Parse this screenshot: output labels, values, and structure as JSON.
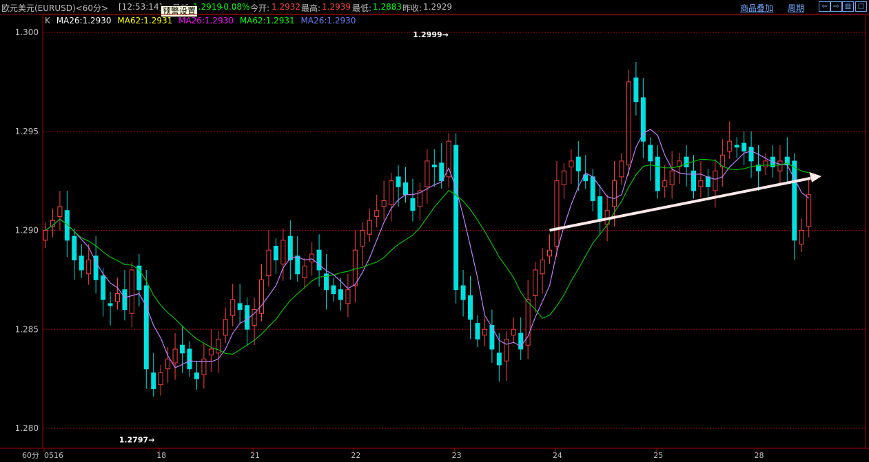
{
  "header": {
    "title": "欧元美元(EURUSD)<60分>",
    "time": "[12:53:14]",
    "latest_label": "最新:",
    "latest": "1.2919",
    "change": "-0.08%",
    "open_label": "今开:",
    "open": "1.2932",
    "high_label": "最高:",
    "high": "1.2939",
    "low_label": "最低:",
    "low": "1.2883",
    "prev_label": "昨收:",
    "prev": "1.2929",
    "overlay_link": "商品叠加",
    "period_link": "周期",
    "tooltip": "预警设置"
  },
  "legend": {
    "k": "K",
    "items": [
      {
        "text": "MA26:1.2930",
        "color": "#ffffff"
      },
      {
        "text": "MA62:1.2931",
        "color": "#ffff00"
      },
      {
        "text": "MA26:1.2930",
        "color": "#ff00ff"
      },
      {
        "text": "MA62:1.2931",
        "color": "#00ff00"
      },
      {
        "text": "MA26:1.2930",
        "color": "#6f7fff"
      }
    ]
  },
  "colors": {
    "up": "#ff4040",
    "down": "#00e0e0",
    "grid": "#a00000",
    "ma_short": "#c080ff",
    "ma_long": "#00c000"
  },
  "chart_data": {
    "type": "candlestick",
    "ylim": [
      1.2785,
      1.3015
    ],
    "yticks": [
      "1.300",
      "1.295",
      "1.290",
      "1.285",
      "1.280"
    ],
    "ytick_values": [
      1.3,
      1.295,
      1.29,
      1.285,
      1.28
    ],
    "period_label": "60分",
    "xticks": [
      {
        "label": "0516",
        "index": 0
      },
      {
        "label": "18",
        "index": 16
      },
      {
        "label": "21",
        "index": 29
      },
      {
        "label": "22",
        "index": 43
      },
      {
        "label": "23",
        "index": 57
      },
      {
        "label": "24",
        "index": 71
      },
      {
        "label": "25",
        "index": 85
      },
      {
        "label": "28",
        "index": 99
      }
    ],
    "closes": [
      1.29,
      1.2905,
      1.2912,
      1.2895,
      1.2885,
      1.288,
      1.2885,
      1.2875,
      1.2865,
      1.2862,
      1.2868,
      1.286,
      1.288,
      1.287,
      1.283,
      1.282,
      1.2828,
      1.2835,
      1.284,
      1.2838,
      1.283,
      1.2825,
      1.2835,
      1.284,
      1.2845,
      1.2855,
      1.2865,
      1.286,
      1.285,
      1.286,
      1.2875,
      1.289,
      1.2885,
      1.2895,
      1.2885,
      1.2878,
      1.2882,
      1.2888,
      1.288,
      1.287,
      1.2868,
      1.2865,
      1.287,
      1.289,
      1.29,
      1.2905,
      1.291,
      1.2915,
      1.2925,
      1.2922,
      1.2918,
      1.291,
      1.292,
      1.2935,
      1.2932,
      1.2925,
      1.2945,
      1.287,
      1.2865,
      1.2855,
      1.2845,
      1.285,
      1.284,
      1.2832,
      1.2845,
      1.285,
      1.284,
      1.2865,
      1.288,
      1.2885,
      1.289,
      1.2925,
      1.293,
      1.2935,
      1.293,
      1.2925,
      1.2915,
      1.2905,
      1.291,
      1.2925,
      1.2935,
      1.2975,
      1.2965,
      1.2945,
      1.2935,
      1.292,
      1.2925,
      1.293,
      1.2935,
      1.2932,
      1.292,
      1.2925,
      1.2922,
      1.293,
      1.2938,
      1.2945,
      1.2942,
      1.294,
      1.2935,
      1.293,
      1.2935,
      1.2932,
      1.2935,
      1.2933,
      1.2895,
      1.29,
      1.2918
    ],
    "annotations": [
      {
        "text": "1.2999",
        "index": 56,
        "value": 1.2999
      },
      {
        "text": "1.2797",
        "index": 15,
        "value": 1.2797
      }
    ],
    "trendline": {
      "from": {
        "index": 70,
        "value": 1.29
      },
      "to": {
        "index": 107,
        "value": 1.2927
      }
    }
  }
}
